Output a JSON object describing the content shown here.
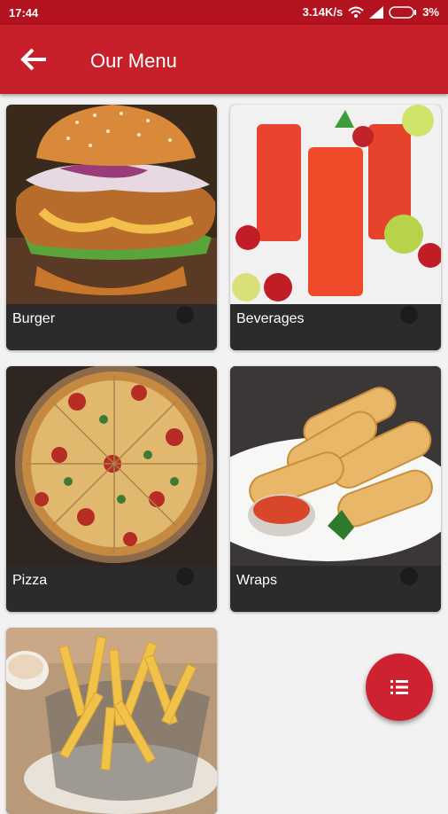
{
  "status_bar": {
    "time": "17:44",
    "network_speed": "3.14K/s",
    "battery": "3%",
    "icons": [
      "wifi-icon",
      "signal-icon",
      "battery-icon"
    ]
  },
  "app_bar": {
    "title": "Our Menu",
    "back_icon": "arrow-back-icon",
    "color": "#c8202b"
  },
  "menu": {
    "items": [
      {
        "label": "Burger"
      },
      {
        "label": "Beverages"
      },
      {
        "label": "Pizza"
      },
      {
        "label": "Wraps"
      },
      {
        "label": "Fries"
      }
    ]
  },
  "fab": {
    "icon": "list-icon",
    "color": "#cf2230"
  }
}
